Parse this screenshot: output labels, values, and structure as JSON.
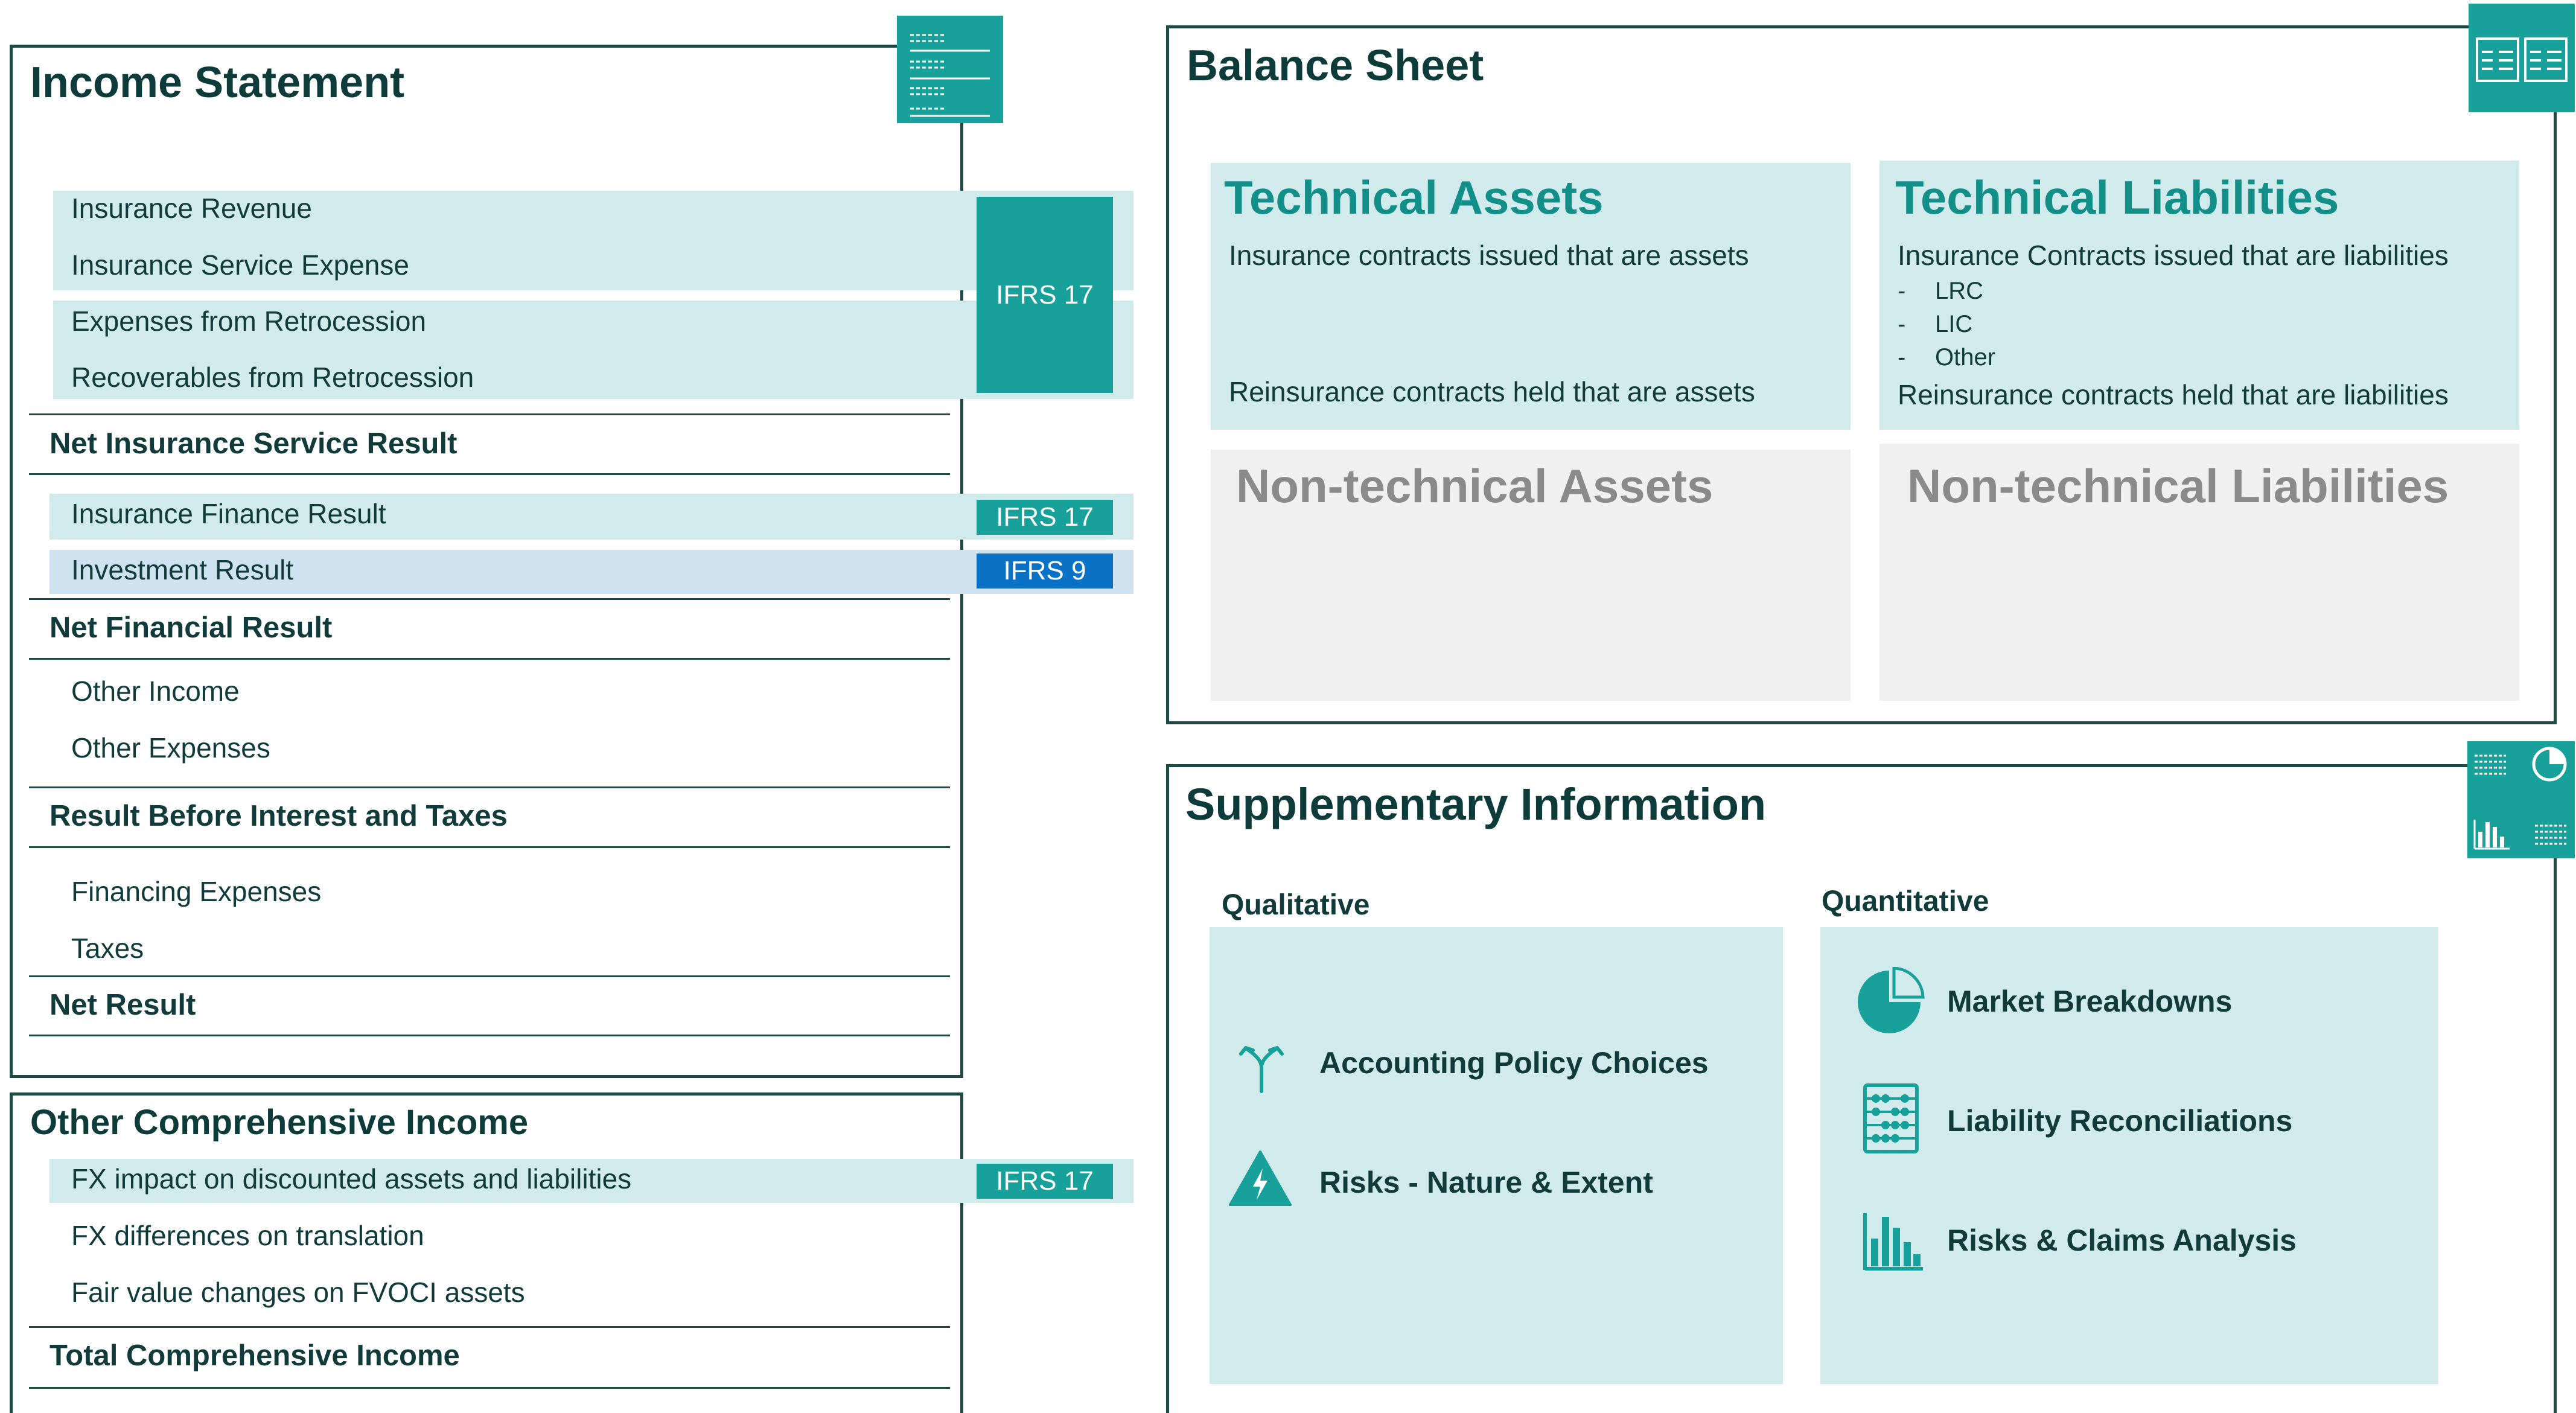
{
  "income_statement": {
    "title": "Income Statement",
    "rows": {
      "insurance_revenue": "Insurance Revenue",
      "insurance_service_expense": "Insurance Service Expense",
      "expenses_retro": "Expenses from Retrocession",
      "recoverables_retro": "Recoverables from Retrocession",
      "net_insurance_service_result": "Net Insurance Service Result",
      "insurance_finance_result": "Insurance Finance Result",
      "investment_result": "Investment Result",
      "net_financial_result": "Net Financial Result",
      "other_income": "Other Income",
      "other_expenses": "Other Expenses",
      "result_before_interest_taxes": "Result Before Interest and Taxes",
      "financing_expenses": "Financing Expenses",
      "taxes": "Taxes",
      "net_result": "Net Result"
    }
  },
  "other_comprehensive_income": {
    "title": "Other Comprehensive Income",
    "rows": {
      "fx_impact": "FX impact on discounted assets and liabilities",
      "fx_differences": "FX differences on translation",
      "fair_value_changes": "Fair value changes on FVOCI assets",
      "total": "Total Comprehensive Income"
    }
  },
  "tags": {
    "ifrs17": "IFRS 17",
    "ifrs9": "IFRS 9"
  },
  "balance_sheet": {
    "title": "Balance Sheet",
    "technical_assets": {
      "heading": "Technical Assets",
      "line1": "Insurance contracts issued that are assets",
      "line2": "Reinsurance contracts held that are assets"
    },
    "technical_liabilities": {
      "heading": "Technical Liabilities",
      "line1": "Insurance Contracts issued that are liabilities",
      "bullets": [
        "LRC",
        "LIC",
        "Other"
      ],
      "bullet_marker": "-",
      "line2": "Reinsurance contracts held that are liabilities"
    },
    "non_technical_assets": "Non-technical Assets",
    "non_technical_liabilities": "Non-technical Liabilities"
  },
  "supplementary": {
    "title": "Supplementary Information",
    "qualitative_label": "Qualitative",
    "quantitative_label": "Quantitative",
    "qualitative_items": {
      "policy": "Accounting Policy Choices",
      "risks": "Risks - Nature & Extent"
    },
    "quantitative_items": {
      "market": "Market Breakdowns",
      "liability": "Liability Reconciliations",
      "claims": "Risks & Claims Analysis"
    }
  },
  "colors": {
    "teal": "#18a09a",
    "light_teal": "#d1ebec",
    "blue": "#0a72c4",
    "light_blue": "#cfe2f0",
    "dark_green": "#1d4a45",
    "grey_box": "#f0f0f0"
  }
}
